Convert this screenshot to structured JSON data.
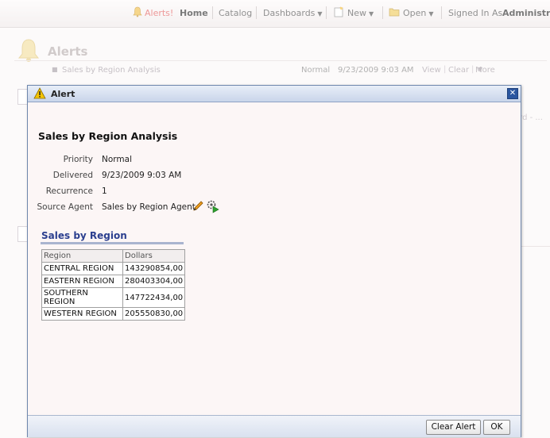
{
  "topbar": {
    "alerts_label": "Alerts!",
    "home_label": "Home",
    "catalog_label": "Catalog",
    "dashboards_label": "Dashboards",
    "new_label": "New",
    "open_label": "Open",
    "signed_in_label": "Signed In As",
    "user_label": "Administrat"
  },
  "background": {
    "title": "Alerts",
    "alert_row": {
      "name": "Sales by Region Analysis",
      "priority": "Normal",
      "timestamp": "9/23/2009 9:03 AM",
      "view_label": "View",
      "clear_label": "Clear",
      "more_label": "More"
    },
    "right_fragment": "ard - ..."
  },
  "dialog": {
    "title": "Alert",
    "report_name": "Sales by Region Analysis",
    "properties": [
      {
        "label": "Priority",
        "value": "Normal"
      },
      {
        "label": "Delivered",
        "value": "9/23/2009 9:03 AM"
      },
      {
        "label": "Recurrence",
        "value": "1"
      },
      {
        "label": "Source Agent",
        "value": "Sales by Region Agent"
      }
    ],
    "section_title": "Sales by Region",
    "table": {
      "headers": [
        "Region",
        "Dollars"
      ],
      "rows": [
        [
          "CENTRAL REGION",
          "143290854,00"
        ],
        [
          "EASTERN REGION",
          "280403304,00"
        ],
        [
          "SOUTHERN REGION",
          "147722434,00"
        ],
        [
          "WESTERN REGION",
          "205550830,00"
        ]
      ]
    },
    "buttons": {
      "clear_alert": "Clear Alert",
      "ok": "OK"
    },
    "icons": [
      "warning-icon",
      "close-icon",
      "pencil-icon",
      "agent-run-icon"
    ]
  },
  "colors": {
    "section_title": "#2b3f8f",
    "dialog_border": "#6f87ad",
    "alerts_link": "#e46060"
  }
}
